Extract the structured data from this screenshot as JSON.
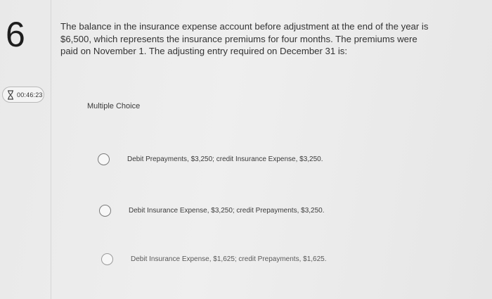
{
  "question": {
    "number": "6",
    "text": "The balance in the insurance expense account before adjustment at the end of the year is $6,500, which represents the insurance premiums for four months. The premiums were paid on November 1. The adjusting entry required on December 31 is:"
  },
  "timer": {
    "icon": "hourglass-icon",
    "value": "00:46:23"
  },
  "multiple_choice": {
    "label": "Multiple Choice",
    "options": [
      {
        "label": "Debit Prepayments, $3,250; credit Insurance Expense, $3,250."
      },
      {
        "label": "Debit Insurance Expense, $3,250; credit Prepayments, $3,250."
      },
      {
        "label": "Debit Insurance Expense, $1,625; credit Prepayments, $1,625."
      }
    ]
  }
}
